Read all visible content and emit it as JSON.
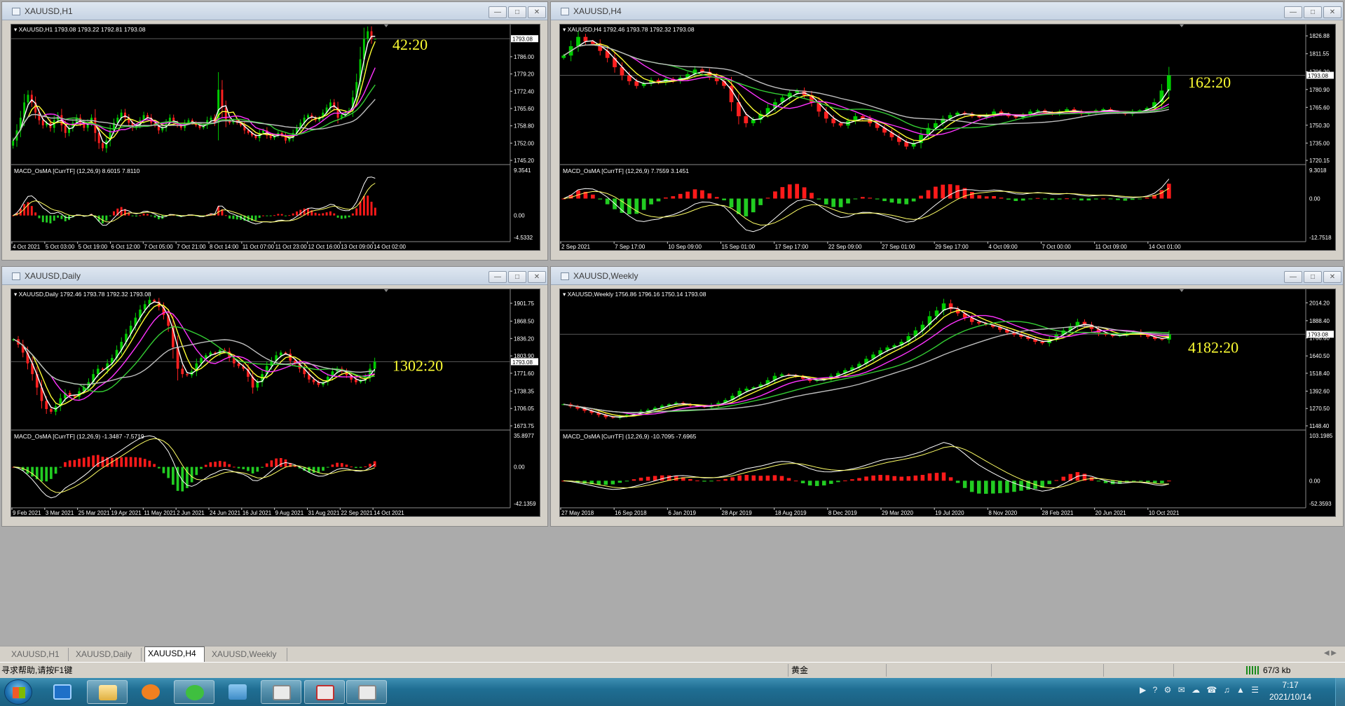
{
  "colors": {
    "bg": "#000000",
    "text": "#ffffff",
    "grid": "#5a5a5a",
    "bull": "#00cc00",
    "bear": "#ff2020",
    "ma_white": "#ffffff",
    "ma_yellow": "#ffff33",
    "ma_magenta": "#ff33ff",
    "ma_green": "#33cc33",
    "ma_gray": "#bdbdbd",
    "countdown": "#ffff33",
    "hist_pos": "#ff1a1a",
    "hist_neg": "#22cc22",
    "sig1": "#ffffff",
    "sig2": "#ffff66"
  },
  "windows": [
    {
      "id": "h1",
      "title": "XAUUSD,H1",
      "header": "XAUUSD,H1  1793.08 1793.22 1792.81 1793.08",
      "countdown": "42:20",
      "price_label": "1793.08",
      "macd_header": "MACD_OsMA [CurrTF] (12,26,9) 8.6015 7.8110"
    },
    {
      "id": "h4",
      "title": "XAUUSD,H4",
      "header": "XAUUSD,H4  1792.46 1793.78 1792.32 1793.08",
      "countdown": "162:20",
      "price_label": "1793.08",
      "macd_header": "MACD_OsMA [CurrTF] (12,26,9) 7.7559 3.1451"
    },
    {
      "id": "daily",
      "title": "XAUUSD,Daily",
      "header": "XAUUSD,Daily  1792.46 1793.78 1792.32 1793.08",
      "countdown": "1302:20",
      "price_label": "1793.08",
      "macd_header": "MACD_OsMA [CurrTF] (12,26,9) -1.3487 -7.5719"
    },
    {
      "id": "weekly",
      "title": "XAUUSD,Weekly",
      "header": "XAUUSD,Weekly  1756.86 1796.16 1750.14 1793.08",
      "countdown": "4182:20",
      "price_label": "1793.08",
      "macd_header": "MACD_OsMA [CurrTF] (12,26,9) -10.7095 -7.6965"
    }
  ],
  "tabs": [
    "XAUUSD,H1",
    "XAUUSD,Daily",
    "XAUUSD,H4",
    "XAUUSD,Weekly"
  ],
  "active_tab": "XAUUSD,H4",
  "status": {
    "help": "寻求帮助,请按F1键",
    "profile": "黄金",
    "traffic": "67/3 kb"
  },
  "clock": {
    "time": "7:17",
    "date": "2021/10/14"
  },
  "chart_data": [
    {
      "id": "h1",
      "type": "candlestick",
      "last": 1793.08,
      "price_axis": [
        1793.08,
        1786.0,
        1779.2,
        1772.4,
        1765.6,
        1758.8,
        1752.0,
        1745.2
      ],
      "ylim": [
        1745.2,
        1797.0
      ],
      "x_labels": [
        "4 Oct 2021",
        "5 Oct 03:00",
        "5 Oct 19:00",
        "6 Oct 12:00",
        "7 Oct 05:00",
        "7 Oct 21:00",
        "8 Oct 14:00",
        "11 Oct 07:00",
        "11 Oct 23:00",
        "12 Oct 16:00",
        "13 Oct 09:00",
        "14 Oct 02:00"
      ],
      "closes": [
        1753,
        1757,
        1762,
        1768,
        1771,
        1768,
        1764,
        1761,
        1759,
        1760,
        1758,
        1761,
        1763,
        1759,
        1756,
        1758,
        1760,
        1762,
        1760,
        1758,
        1760,
        1762,
        1756,
        1752,
        1750,
        1753,
        1757,
        1760,
        1762,
        1764,
        1762,
        1760,
        1758,
        1759,
        1761,
        1763,
        1762,
        1760,
        1759,
        1757,
        1758,
        1760,
        1762,
        1760,
        1759,
        1758,
        1760,
        1761,
        1760,
        1759,
        1758,
        1759,
        1761,
        1762,
        1760,
        1773,
        1766,
        1761,
        1760,
        1761,
        1760,
        1759,
        1757,
        1756,
        1755,
        1754,
        1756,
        1757,
        1755,
        1754,
        1755,
        1756,
        1755,
        1753,
        1754,
        1756,
        1758,
        1760,
        1762,
        1763,
        1762,
        1761,
        1762,
        1764,
        1766,
        1768,
        1766,
        1762,
        1763,
        1764,
        1765,
        1770,
        1776,
        1785,
        1793,
        1796,
        1793,
        1793
      ],
      "macd": {
        "header_values": [
          8.6015,
          7.811
        ],
        "axis": [
          9.3541,
          0.0,
          -4.5332
        ],
        "ylim": [
          -4.5332,
          9.3541
        ]
      }
    },
    {
      "id": "h4",
      "type": "candlestick",
      "last": 1793.08,
      "price_axis": [
        1826.88,
        1811.55,
        1796.2,
        1793.08,
        1780.9,
        1765.6,
        1750.3,
        1735.0,
        1720.15
      ],
      "ylim": [
        1720.15,
        1833
      ],
      "x_labels": [
        "2 Sep 2021",
        "7 Sep 17:00",
        "10 Sep 09:00",
        "15 Sep 01:00",
        "17 Sep 17:00",
        "22 Sep 09:00",
        "27 Sep 01:00",
        "29 Sep 17:00",
        "4 Oct 09:00",
        "7 Oct 00:00",
        "11 Oct 09:00",
        "14 Oct 01:00"
      ],
      "closes": [
        1810,
        1818,
        1826,
        1822,
        1820,
        1814,
        1808,
        1800,
        1793,
        1788,
        1784,
        1786,
        1789,
        1787,
        1790,
        1788,
        1791,
        1794,
        1798,
        1796,
        1792,
        1788,
        1784,
        1770,
        1758,
        1752,
        1755,
        1760,
        1765,
        1770,
        1774,
        1778,
        1780,
        1776,
        1770,
        1762,
        1756,
        1752,
        1750,
        1754,
        1758,
        1756,
        1752,
        1748,
        1744,
        1740,
        1736,
        1732,
        1735,
        1742,
        1748,
        1752,
        1756,
        1759,
        1761,
        1760,
        1758,
        1757,
        1759,
        1762,
        1760,
        1758,
        1757,
        1759,
        1762,
        1763,
        1761,
        1760,
        1762,
        1764,
        1762,
        1760,
        1761,
        1763,
        1764,
        1762,
        1761,
        1760,
        1762,
        1763,
        1765,
        1770,
        1780,
        1793
      ],
      "macd": {
        "header_values": [
          7.7559,
          3.1451
        ],
        "axis": [
          9.3018,
          0.0,
          -12.7518
        ],
        "ylim": [
          -12.7518,
          9.3018
        ]
      }
    },
    {
      "id": "daily",
      "type": "candlestick",
      "last": 1793.08,
      "price_axis": [
        1901.75,
        1868.5,
        1836.2,
        1803.9,
        1793.08,
        1771.6,
        1738.35,
        1706.05,
        1673.75
      ],
      "ylim": [
        1673.75,
        1920
      ],
      "x_labels": [
        "9 Feb 2021",
        "3 Mar 2021",
        "25 Mar 2021",
        "19 Apr 2021",
        "11 May 2021",
        "2 Jun 2021",
        "24 Jun 2021",
        "16 Jul 2021",
        "9 Aug 2021",
        "31 Aug 2021",
        "22 Sep 2021",
        "14 Oct 2021"
      ],
      "closes": [
        1835,
        1825,
        1810,
        1790,
        1770,
        1745,
        1720,
        1705,
        1700,
        1710,
        1725,
        1735,
        1730,
        1728,
        1738,
        1745,
        1755,
        1770,
        1780,
        1778,
        1790,
        1800,
        1815,
        1830,
        1845,
        1860,
        1875,
        1890,
        1900,
        1908,
        1905,
        1895,
        1880,
        1860,
        1820,
        1780,
        1770,
        1768,
        1775,
        1790,
        1800,
        1805,
        1810,
        1808,
        1815,
        1812,
        1800,
        1790,
        1785,
        1780,
        1765,
        1745,
        1755,
        1770,
        1785,
        1795,
        1805,
        1810,
        1808,
        1795,
        1790,
        1780,
        1770,
        1760,
        1755,
        1750,
        1755,
        1765,
        1775,
        1780,
        1775,
        1768,
        1760,
        1755,
        1758,
        1765,
        1780,
        1793
      ],
      "macd": {
        "header_values": [
          -1.3487,
          -7.5719
        ],
        "axis": [
          35.8977,
          0.0,
          -42.1359
        ],
        "ylim": [
          -42.1359,
          35.8977
        ]
      }
    },
    {
      "id": "weekly",
      "type": "candlestick",
      "last": 1793.08,
      "price_axis": [
        2014.2,
        1888.4,
        1793.08,
        1766.6,
        1640.5,
        1518.4,
        1392.6,
        1270.5,
        1148.4
      ],
      "ylim": [
        1148.4,
        2080
      ],
      "x_labels": [
        "27 May 2018",
        "16 Sep 2018",
        "6 Jan 2019",
        "28 Apr 2019",
        "18 Aug 2019",
        "8 Dec 2019",
        "29 Mar 2020",
        "19 Jul 2020",
        "8 Nov 2020",
        "28 Feb 2021",
        "20 Jun 2021",
        "10 Oct 2021"
      ],
      "closes": [
        1300,
        1285,
        1270,
        1255,
        1240,
        1225,
        1210,
        1205,
        1215,
        1225,
        1235,
        1250,
        1260,
        1275,
        1290,
        1300,
        1310,
        1300,
        1290,
        1285,
        1280,
        1295,
        1310,
        1330,
        1360,
        1395,
        1410,
        1420,
        1440,
        1470,
        1500,
        1510,
        1505,
        1495,
        1480,
        1465,
        1470,
        1480,
        1500,
        1520,
        1540,
        1560,
        1585,
        1620,
        1650,
        1680,
        1700,
        1715,
        1740,
        1780,
        1820,
        1860,
        1920,
        1960,
        2010,
        1970,
        1940,
        1910,
        1880,
        1870,
        1860,
        1845,
        1825,
        1805,
        1790,
        1775,
        1760,
        1740,
        1730,
        1760,
        1790,
        1820,
        1850,
        1880,
        1860,
        1830,
        1800,
        1790,
        1780,
        1785,
        1800,
        1810,
        1790,
        1775,
        1760,
        1755,
        1793
      ],
      "macd": {
        "header_values": [
          -10.7095,
          -7.6965
        ],
        "axis": [
          103.1985,
          0.0,
          -52.3593
        ],
        "ylim": [
          -52.3593,
          103.1985
        ]
      }
    }
  ]
}
